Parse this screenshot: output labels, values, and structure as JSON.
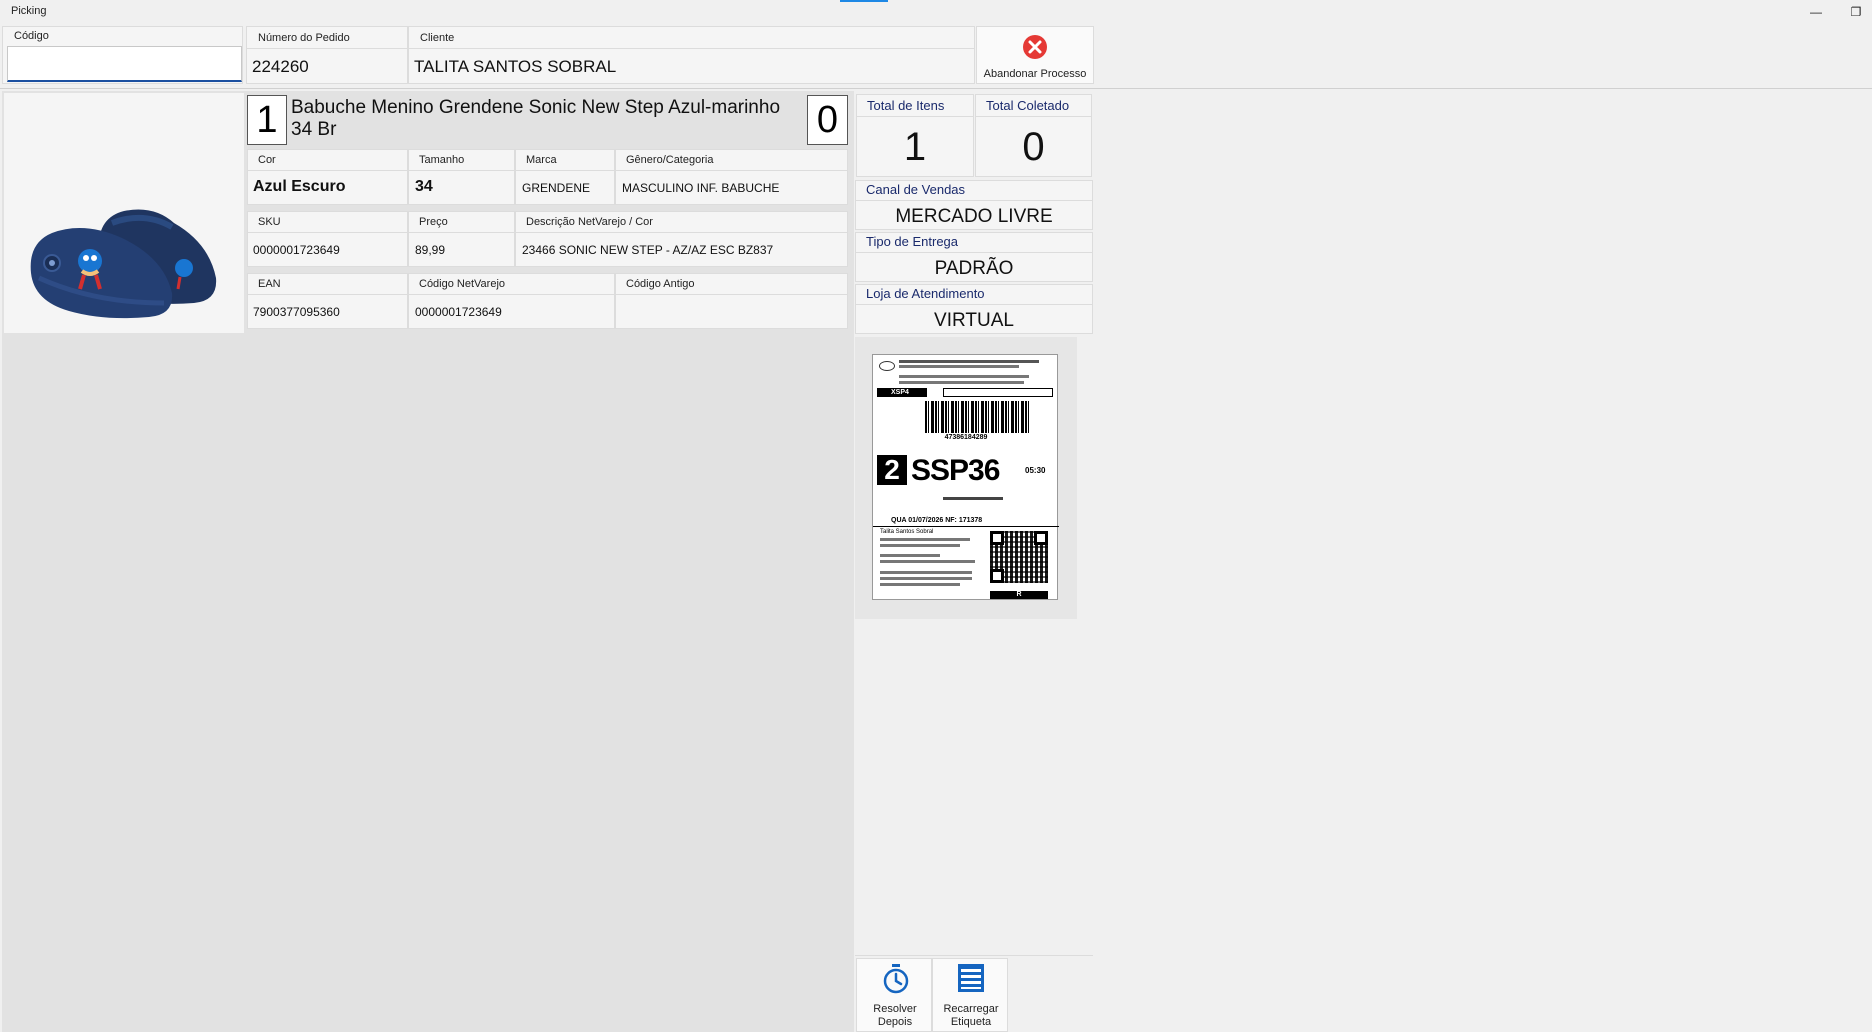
{
  "window": {
    "title": "Picking"
  },
  "codigo": {
    "label": "Código",
    "value": ""
  },
  "pedido": {
    "label": "Número do Pedido",
    "value": "224260"
  },
  "cliente": {
    "label": "Cliente",
    "value": "TALITA SANTOS SOBRAL"
  },
  "abandonar": {
    "label": "Abandonar Processo"
  },
  "product": {
    "qty_left": "1",
    "name": "Babuche Menino Grendene Sonic New Step Azul-marinho 34 Br",
    "qty_right": "0",
    "cor": {
      "label": "Cor",
      "value": "Azul Escuro"
    },
    "tamanho": {
      "label": "Tamanho",
      "value": "34"
    },
    "marca": {
      "label": "Marca",
      "value": "GRENDENE"
    },
    "genero": {
      "label": "Gênero/Categoria",
      "value": "MASCULINO INF. BABUCHE"
    },
    "sku": {
      "label": "SKU",
      "value": "0000001723649"
    },
    "preco": {
      "label": "Preço",
      "value": "89,99"
    },
    "descricao": {
      "label": "Descrição NetVarejo / Cor",
      "value": "23466 SONIC NEW STEP - AZ/AZ ESC BZ837"
    },
    "ean": {
      "label": "EAN",
      "value": "7900377095360"
    },
    "codigo_netvarejo": {
      "label": "Código NetVarejo",
      "value": "0000001723649"
    },
    "codigo_antigo": {
      "label": "Código Antigo",
      "value": ""
    }
  },
  "totals": {
    "itens_label": "Total de Itens",
    "itens_value": "1",
    "coletado_label": "Total Coletado",
    "coletado_value": "0"
  },
  "canal": {
    "label": "Canal de Vendas",
    "value": "MERCADO LIVRE"
  },
  "entrega": {
    "label": "Tipo de Entrega",
    "value": "PADRÃO"
  },
  "loja": {
    "label": "Loja de Atendimento",
    "value": "VIRTUAL"
  },
  "shipping_label": {
    "route": "XSP4",
    "route_code": "SSP36",
    "route_number": "2",
    "time": "05:30",
    "barcode_number": "47386184289",
    "date_line": "QUA 01/07/2026   NF: 171378",
    "recipient": "Talita Santos Sobral",
    "footer": "R"
  },
  "actions": {
    "resolver": "Resolver Depois",
    "recarregar": "Recarregar Etiqueta"
  },
  "colors": {
    "navy": "#1a2a6c",
    "close_red": "#e53935",
    "accent": "#1e88e5"
  }
}
